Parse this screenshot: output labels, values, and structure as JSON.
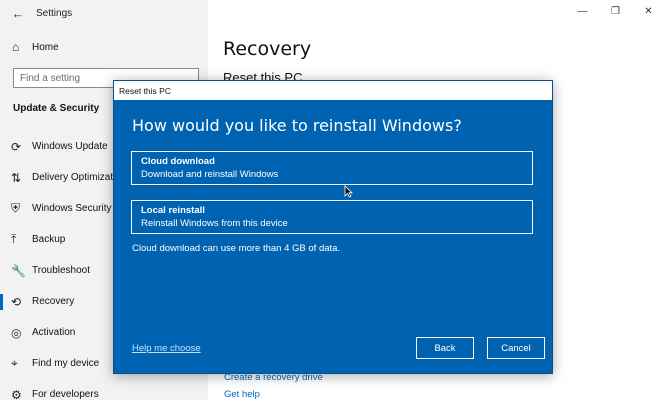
{
  "window": {
    "app_title": "Settings",
    "back_glyph": "←",
    "minimize_glyph": "—",
    "maximize_glyph": "❐",
    "close_glyph": "✕"
  },
  "sidebar": {
    "home_label": "Home",
    "search_placeholder": "Find a setting",
    "section_title": "Update & Security",
    "items": [
      {
        "label": "Windows Update",
        "icon": "sync-icon",
        "glyph": "⟳"
      },
      {
        "label": "Delivery Optimization",
        "icon": "delivery-icon",
        "glyph": "⇅"
      },
      {
        "label": "Windows Security",
        "icon": "shield-icon",
        "glyph": "⛨"
      },
      {
        "label": "Backup",
        "icon": "backup-icon",
        "glyph": "⤒"
      },
      {
        "label": "Troubleshoot",
        "icon": "wrench-icon",
        "glyph": "🔧"
      },
      {
        "label": "Recovery",
        "icon": "recovery-icon",
        "glyph": "⟲"
      },
      {
        "label": "Activation",
        "icon": "activation-icon",
        "glyph": "◎"
      },
      {
        "label": "Find my device",
        "icon": "find-device-icon",
        "glyph": "⌖"
      },
      {
        "label": "For developers",
        "icon": "developers-icon",
        "glyph": "⚙"
      }
    ],
    "active_index": 5
  },
  "content": {
    "page_title": "Recovery",
    "section_heading": "Reset this PC",
    "links": [
      "Create a recovery drive",
      "Get help"
    ]
  },
  "dialog": {
    "title": "Reset this PC",
    "heading": "How would you like to reinstall Windows?",
    "options": [
      {
        "title": "Cloud download",
        "description": "Download and reinstall Windows"
      },
      {
        "title": "Local reinstall",
        "description": "Reinstall Windows from this device"
      }
    ],
    "note": "Cloud download can use more than 4 GB of data.",
    "help_link": "Help me choose",
    "back_button": "Back",
    "cancel_button": "Cancel",
    "background_color": "#0063b1"
  }
}
